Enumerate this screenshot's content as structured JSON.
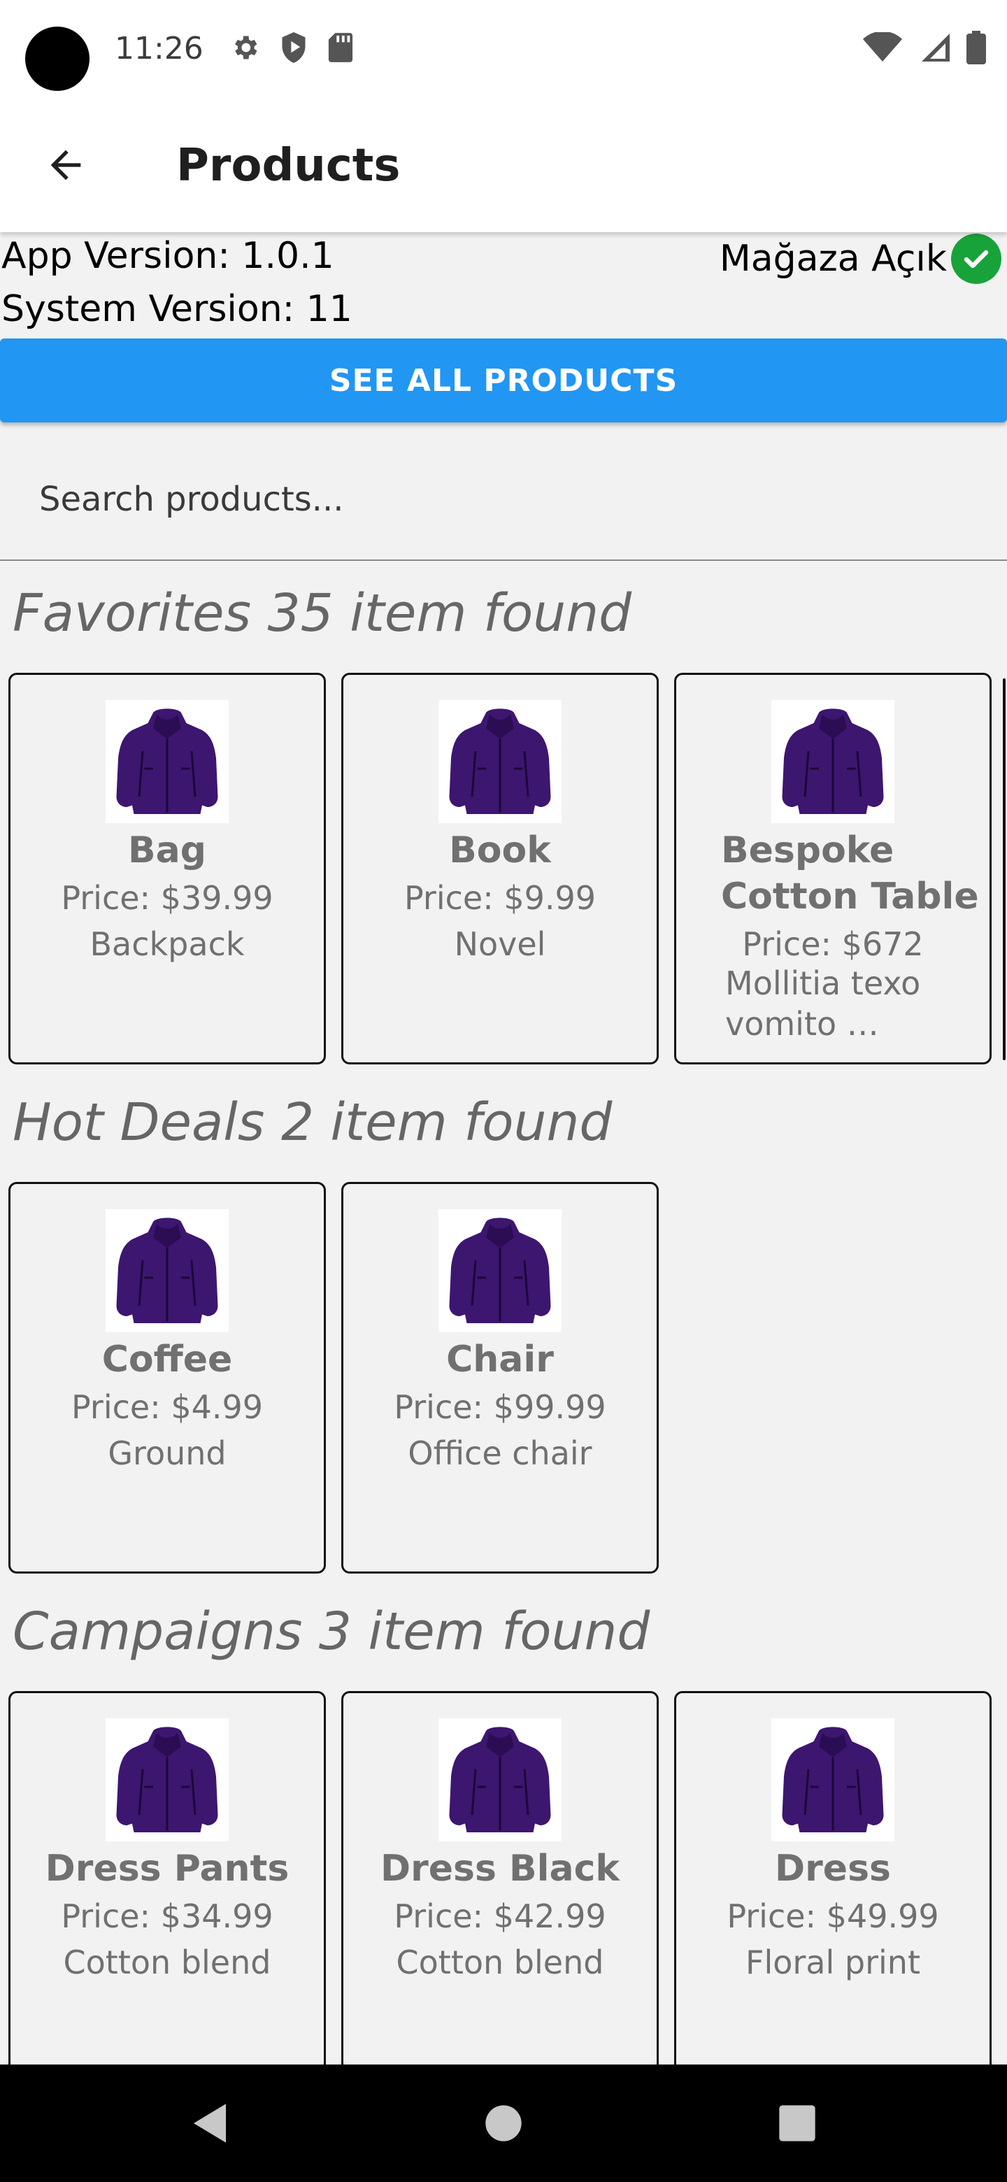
{
  "status_bar": {
    "time": "11:26",
    "left_icons": [
      "gear-icon",
      "shield-play-icon",
      "sd-card-icon"
    ],
    "right_icons": [
      "wifi-icon",
      "cell-signal-icon",
      "battery-icon"
    ]
  },
  "app_bar": {
    "back_icon": "arrow-left-icon",
    "title": "Products"
  },
  "info": {
    "app_version": "App Version: 1.0.1",
    "system_version": "System Version: 11",
    "store_status": "Mağaza Açık",
    "store_status_icon": "check-circle-icon",
    "store_status_color": "#18a33a"
  },
  "see_all_button": {
    "label": "SEE ALL PRODUCTS",
    "color": "#2196f3"
  },
  "search": {
    "placeholder": "Search products..."
  },
  "sections": [
    {
      "title": "Favorites 35 item found",
      "items": [
        {
          "name": "Bag",
          "price": "Price: $39.99",
          "description": "Backpack",
          "image": "purple-jacket-image"
        },
        {
          "name": "Book",
          "price": "Price: $9.99",
          "description": "Novel",
          "image": "purple-jacket-image"
        },
        {
          "name": "Bespoke Cotton Table",
          "price": "Price: $672",
          "description": "Mollitia texo vomito …",
          "image": "purple-jacket-image"
        }
      ]
    },
    {
      "title": "Hot Deals 2 item found",
      "items": [
        {
          "name": "Coffee",
          "price": "Price: $4.99",
          "description": "Ground",
          "image": "purple-jacket-image"
        },
        {
          "name": "Chair",
          "price": "Price: $99.99",
          "description": "Office chair",
          "image": "purple-jacket-image"
        }
      ]
    },
    {
      "title": "Campaigns 3 item found",
      "items": [
        {
          "name": "Dress Pants",
          "price": "Price: $34.99",
          "description": "Cotton blend",
          "image": "purple-jacket-image"
        },
        {
          "name": "Dress Black",
          "price": "Price: $42.99",
          "description": "Cotton blend",
          "image": "purple-jacket-image"
        },
        {
          "name": "Dress",
          "price": "Price: $49.99",
          "description": "Floral print",
          "image": "purple-jacket-image"
        }
      ]
    }
  ],
  "nav_bar": {
    "icons": [
      "back-triangle-icon",
      "home-circle-icon",
      "recents-square-icon"
    ]
  }
}
